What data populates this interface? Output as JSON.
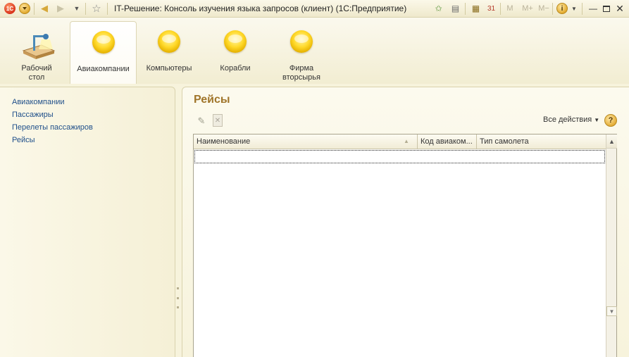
{
  "window": {
    "title": "IT-Решение: Консоль изучения языка запросов (клиент)  (1С:Предприятие)",
    "app_logo_text": "1С",
    "calendar_day": "31",
    "mem_m": "M",
    "mem_mplus": "M+",
    "mem_mminus": "M−"
  },
  "sections": [
    {
      "label": "Рабочий\nстол",
      "icon": "desktop-lamp-icon",
      "active": false
    },
    {
      "label": "Авиакомпании",
      "icon": "section-ball-icon",
      "active": true
    },
    {
      "label": "Компьютеры",
      "icon": "section-ball-icon",
      "active": false
    },
    {
      "label": "Корабли",
      "icon": "section-ball-icon",
      "active": false
    },
    {
      "label": "Фирма\nвторсырья",
      "icon": "section-ball-icon",
      "active": false
    }
  ],
  "nav": {
    "items": [
      "Авиакомпании",
      "Пассажиры",
      "Перелеты пассажиров",
      "Рейсы"
    ]
  },
  "content": {
    "title": "Рейсы",
    "all_actions_label": "Все действия",
    "help_glyph": "?"
  },
  "table": {
    "columns": [
      "Наименование",
      "Код авиаком...",
      "Тип самолета"
    ],
    "rows": []
  },
  "colors": {
    "accent_title": "#a0752a",
    "nav_link": "#1f4f8a",
    "section_ball": "#ffd92a",
    "background": "#f7f3dc"
  }
}
